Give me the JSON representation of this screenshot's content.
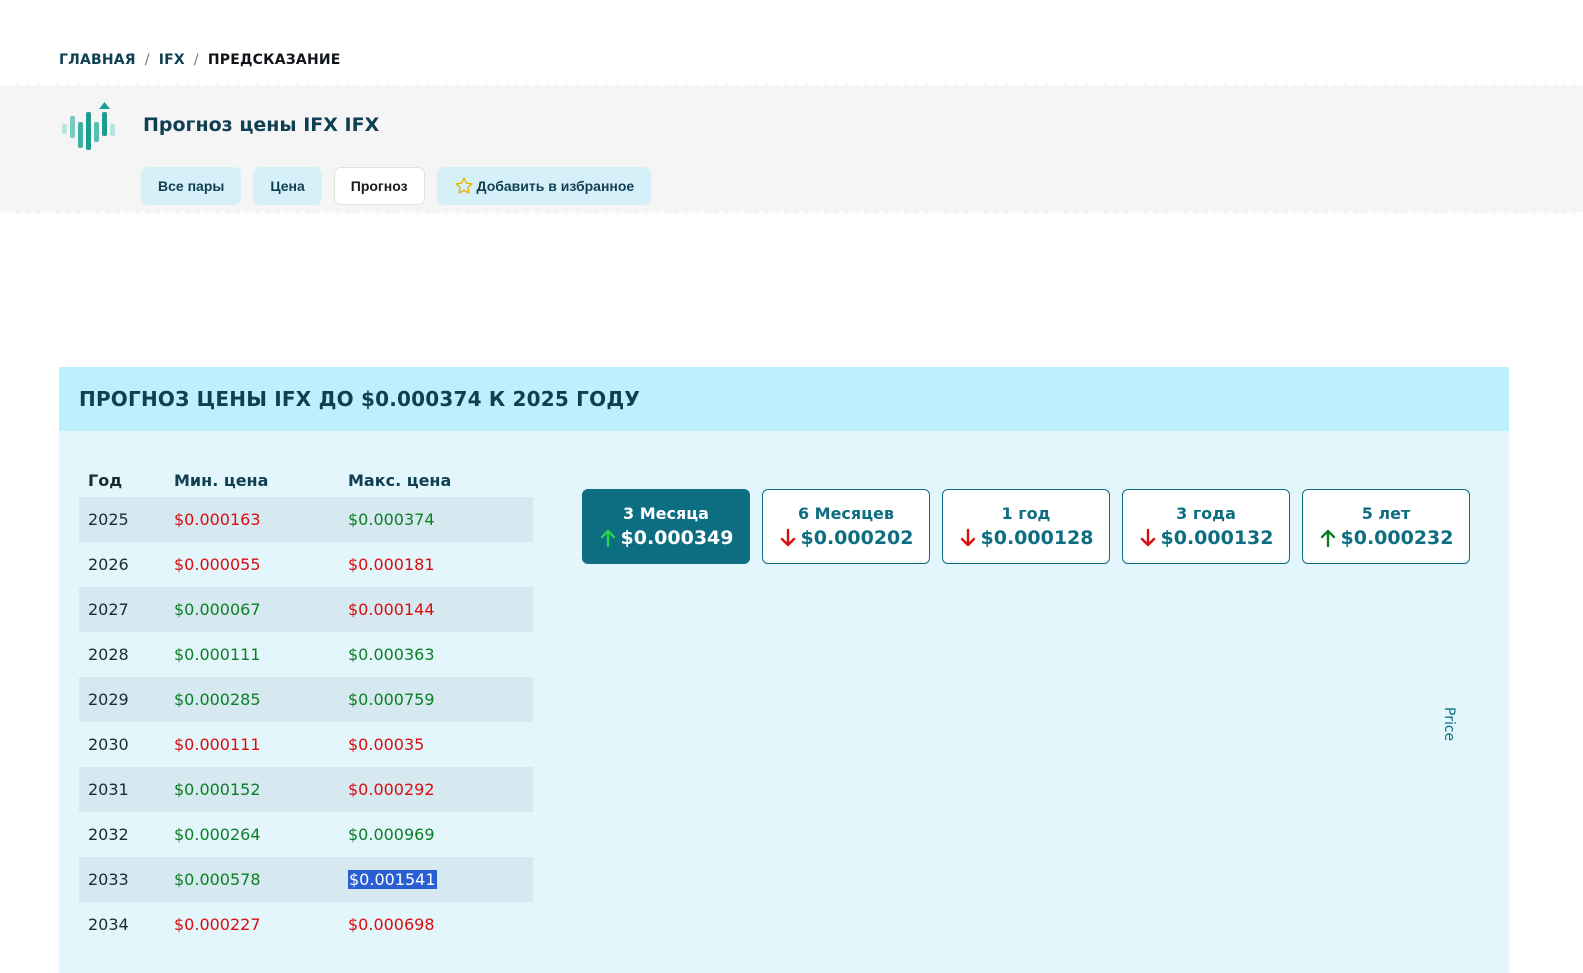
{
  "breadcrumb": {
    "home": "ГЛАВНАЯ",
    "coin": "IFX",
    "current": "ПРЕДСКАЗАНИЕ",
    "separator": "/"
  },
  "header": {
    "title": "Прогноз цены IFX IFX",
    "logo_icon": "chart-growth-icon",
    "nav": {
      "all_pairs": "Все пары",
      "price": "Цена",
      "forecast": "Прогноз",
      "favorite": "Добавить в избранное"
    }
  },
  "panel": {
    "title": "ПРОГНОЗ ЦЕНЫ IFX ДО $0.000374 К 2025 ГОДУ",
    "table": {
      "headers": {
        "year": "Год",
        "min": "Мин. цена",
        "max": "Макс. цена"
      },
      "rows": [
        {
          "year": "2025",
          "min": "$0.000163",
          "max": "$0.000374"
        },
        {
          "year": "2026",
          "min": "$0.000055",
          "max": "$0.000181"
        },
        {
          "year": "2027",
          "min": "$0.000067",
          "max": "$0.000144"
        },
        {
          "year": "2028",
          "min": "$0.000111",
          "max": "$0.000363"
        },
        {
          "year": "2029",
          "min": "$0.000285",
          "max": "$0.000759"
        },
        {
          "year": "2030",
          "min": "$0.000111",
          "max": "$0.00035"
        },
        {
          "year": "2031",
          "min": "$0.000152",
          "max": "$0.000292"
        },
        {
          "year": "2032",
          "min": "$0.000264",
          "max": "$0.000969"
        },
        {
          "year": "2033",
          "min": "$0.000578",
          "max": "$0.001541"
        },
        {
          "year": "2034",
          "min": "$0.000227",
          "max": "$0.000698"
        }
      ]
    },
    "periods": [
      {
        "label": "3 Месяца",
        "value": "$0.000349",
        "trend": "up"
      },
      {
        "label": "6 Месяцев",
        "value": "$0.000202",
        "trend": "down"
      },
      {
        "label": "1 год",
        "value": "$0.000128",
        "trend": "down"
      },
      {
        "label": "3 года",
        "value": "$0.000132",
        "trend": "down"
      },
      {
        "label": "5 лет",
        "value": "$0.000232",
        "trend": "up"
      }
    ],
    "chart_axis_label": "Price"
  },
  "colors": {
    "up": "#0a7f24",
    "down": "#d90d0d",
    "accent": "#0d6e82"
  }
}
